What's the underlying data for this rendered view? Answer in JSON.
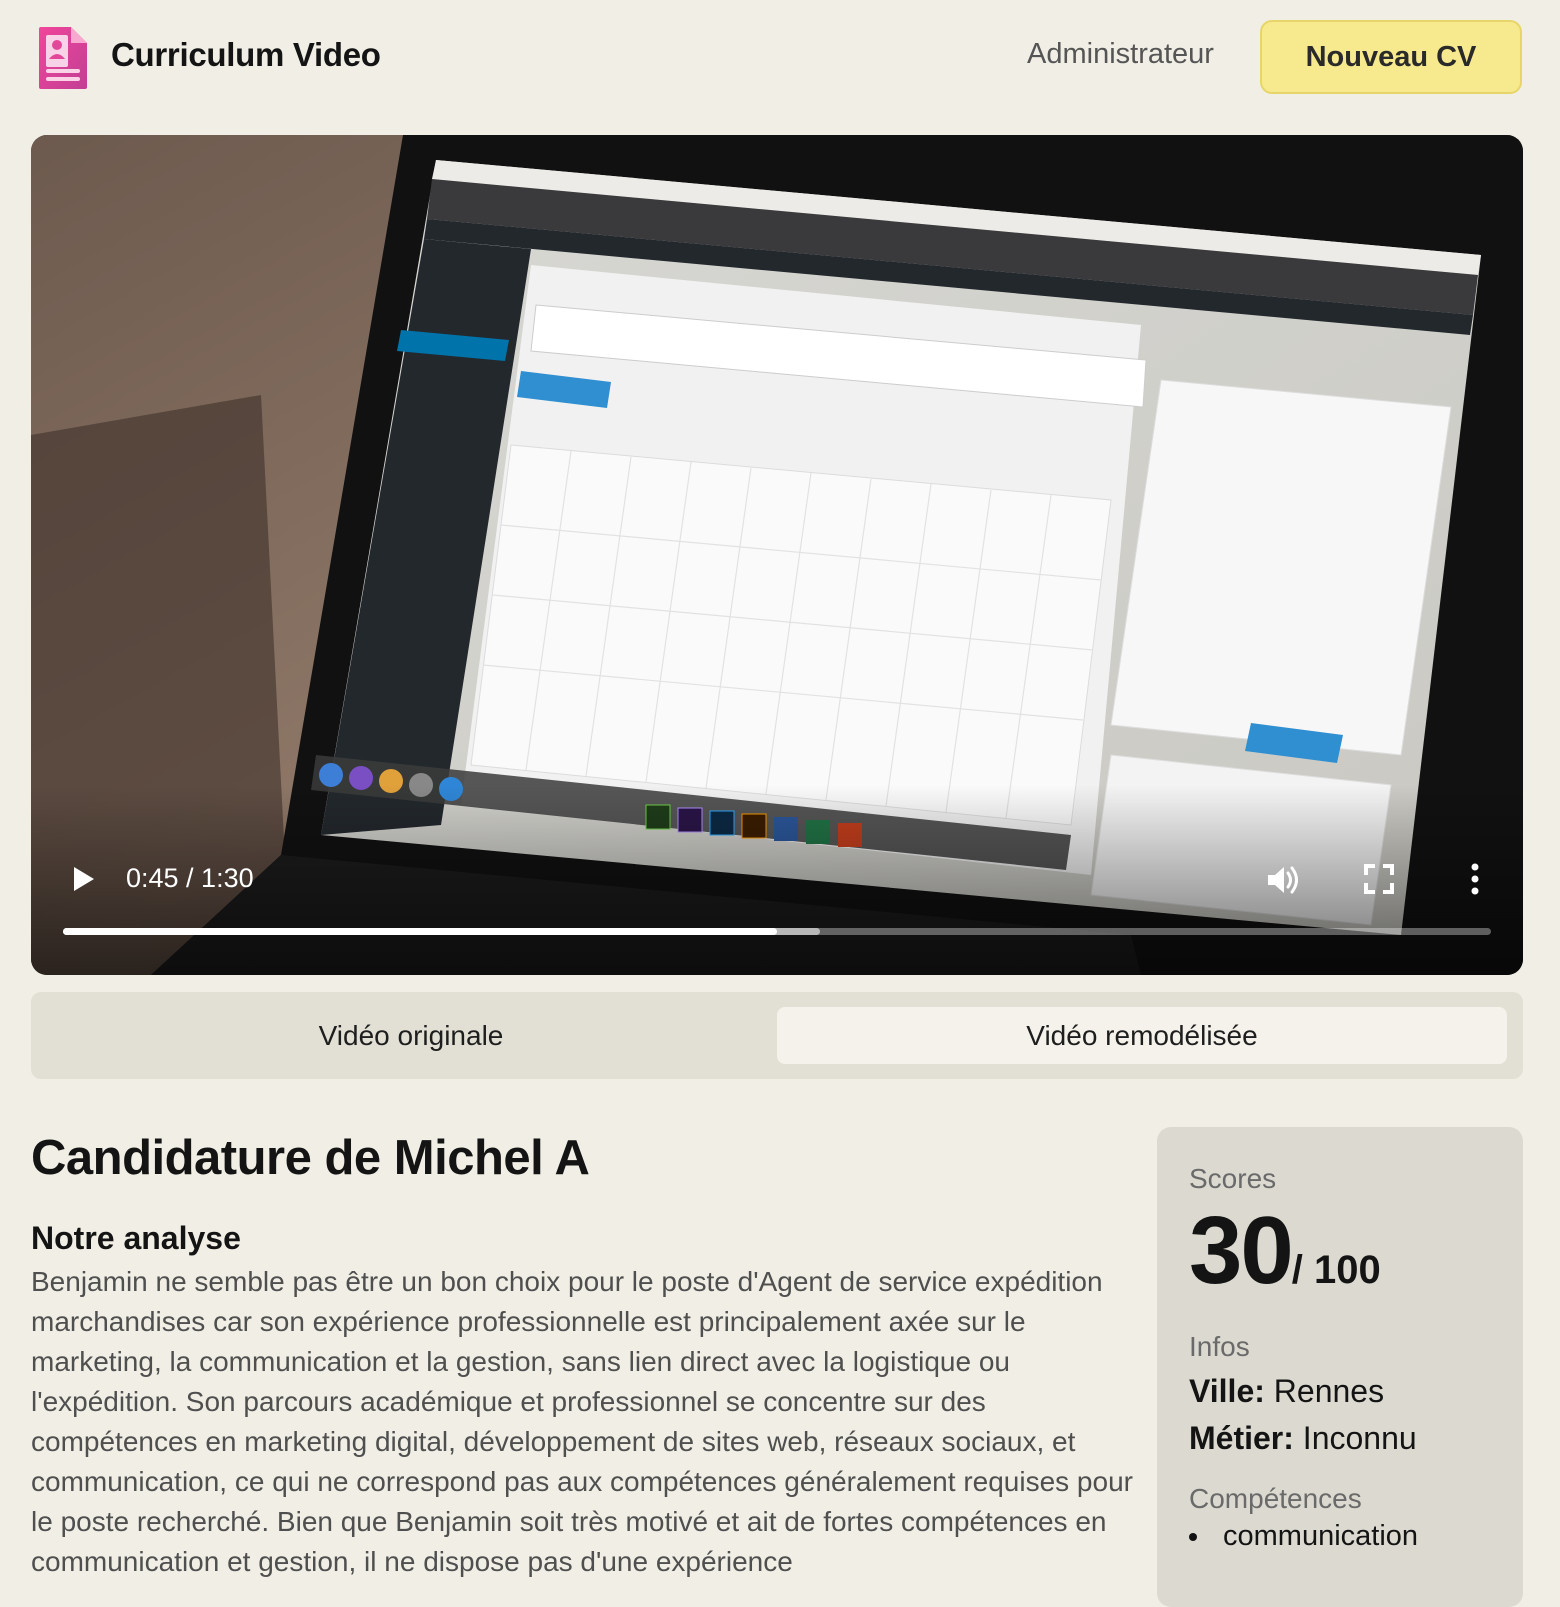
{
  "header": {
    "app_title": "Curriculum Video",
    "admin_link": "Administrateur",
    "new_cv_button": "Nouveau CV"
  },
  "video": {
    "current_time": "0:45",
    "duration": "1:30",
    "time_display": "0:45 / 1:30",
    "progress_fraction": 0.5,
    "buffered_fraction": 0.53,
    "icons": [
      "play-icon",
      "volume-icon",
      "fullscreen-icon",
      "more-vert-icon"
    ]
  },
  "tabs": [
    {
      "label": "Vidéo originale",
      "selected": false
    },
    {
      "label": "Vidéo remodélisée",
      "selected": true
    }
  ],
  "candidate": {
    "title": "Candidature de Michel A",
    "analysis_heading": "Notre analyse",
    "analysis_text": "Benjamin ne semble pas être un bon choix pour le poste d'Agent de service expédition marchandises car son expérience professionnelle est principalement axée sur le marketing, la communication et la gestion, sans lien direct avec la logistique ou l'expédition. Son parcours académique et professionnel se concentre sur des compétences en marketing digital, développement de sites web, réseaux sociaux, et communication, ce qui ne correspond pas aux compétences généralement requises pour le poste recherché. Bien que Benjamin soit très motivé et ait de fortes compétences en communication et gestion, il ne dispose pas d'une expérience"
  },
  "sidebar": {
    "scores_label": "Scores",
    "score": "30",
    "score_max": "/ 100",
    "infos_label": "Infos",
    "city_label": "Ville:",
    "city_value": "Rennes",
    "job_label": "Métier:",
    "job_value": "Inconnu",
    "skills_label": "Compétences",
    "skills": [
      "communication"
    ]
  },
  "colors": {
    "page_bg": "#f1efe5",
    "accent_button": "#f6e98e",
    "logo_pink": "#e2479a"
  }
}
